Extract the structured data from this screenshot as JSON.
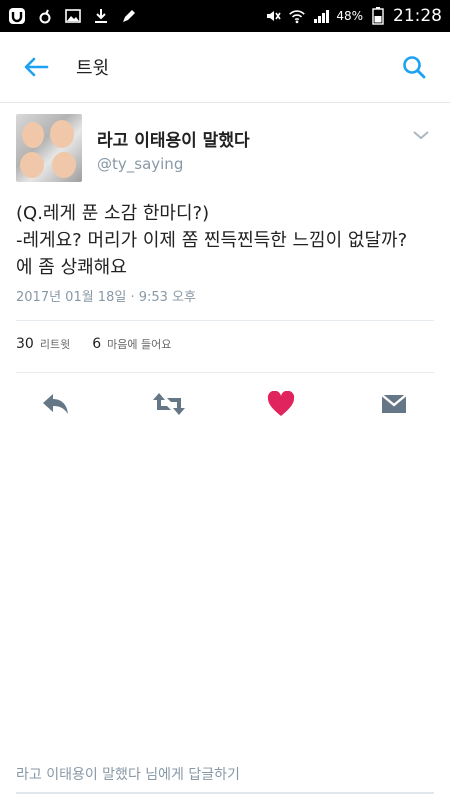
{
  "status_bar": {
    "battery_percent": "48%",
    "time": "21:28",
    "left_icons": [
      "ucloud-icon",
      "female-icon",
      "image-icon",
      "download-icon",
      "pen-icon"
    ],
    "right_icons": [
      "mute-icon",
      "wifi-icon",
      "signal-icon",
      "battery-icon"
    ]
  },
  "app_bar": {
    "title": "트윗",
    "back_icon": "arrow-left-icon",
    "search_icon": "search-icon",
    "accent_color": "#1da1f2"
  },
  "tweet": {
    "display_name": "라고 이태용이 말했다",
    "handle": "@ty_saying",
    "text_lines": [
      "(Q.레게 푼 소감 한마디?)",
      "-레게요? 머리가 이제 쫌 찐득찐득한 느낌이 없달까?",
      "에 좀 상쾌해요"
    ],
    "timestamp": "2017년 01월 18일 · 9:53 오후"
  },
  "stats": {
    "retweets_count": "30",
    "retweets_label": "리트윗",
    "likes_count": "6",
    "likes_label": "마음에 들어요"
  },
  "actions": {
    "reply_icon": "reply-icon",
    "retweet_icon": "retweet-icon",
    "like_icon": "heart-icon",
    "dm_icon": "envelope-icon",
    "like_color": "#e0245e",
    "icon_color": "#657786"
  },
  "reply_bar": {
    "placeholder": "라고 이태용이 말했다 님에게 답글하기"
  }
}
